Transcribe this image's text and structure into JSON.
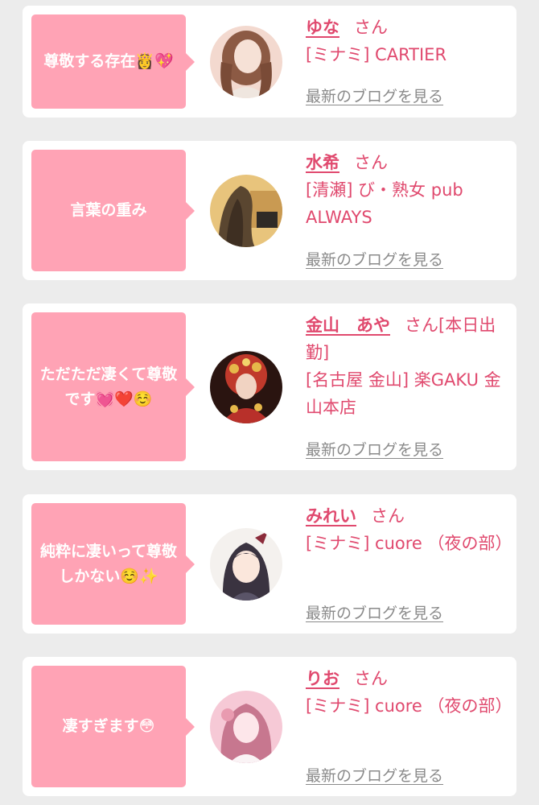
{
  "cards": [
    {
      "message": "尊敬する存在👸💖",
      "name": "ゆな",
      "honorific": "さん",
      "shop": "[ミナミ] CARTIER",
      "blog_link": "最新のブログを見る",
      "avatar_colors": [
        "#f3d9cf",
        "#8c5a44"
      ]
    },
    {
      "message": "言葉の重み",
      "name": "水希",
      "honorific": "さん",
      "shop": "[清瀬] び・熟女 pub ALWAYS",
      "blog_link": "最新のブログを見る",
      "avatar_colors": [
        "#e8c47c",
        "#5a4630"
      ]
    },
    {
      "message": "ただただ凄くて尊敬です💓❤️☺️",
      "name": "金山　あや",
      "honorific": "さん[本日出勤]",
      "shop": "[名古屋 金山] 楽GAKU 金山本店",
      "blog_link": "最新のブログを見る",
      "avatar_colors": [
        "#c0392b",
        "#e6b84a"
      ]
    },
    {
      "message": "純粋に凄いって尊敬しかない☺️✨",
      "name": "みれい",
      "honorific": "さん",
      "shop": "[ミナミ] cuore （夜の部）",
      "blog_link": "最新のブログを見る",
      "avatar_colors": [
        "#f4f1ee",
        "#3a3340"
      ]
    },
    {
      "message": "凄すぎます😳",
      "name": "りお",
      "honorific": "さん",
      "shop": "[ミナミ] cuore （夜の部）",
      "blog_link": "最新のブログを見る",
      "avatar_colors": [
        "#f6c9d6",
        "#c7778f"
      ]
    }
  ]
}
